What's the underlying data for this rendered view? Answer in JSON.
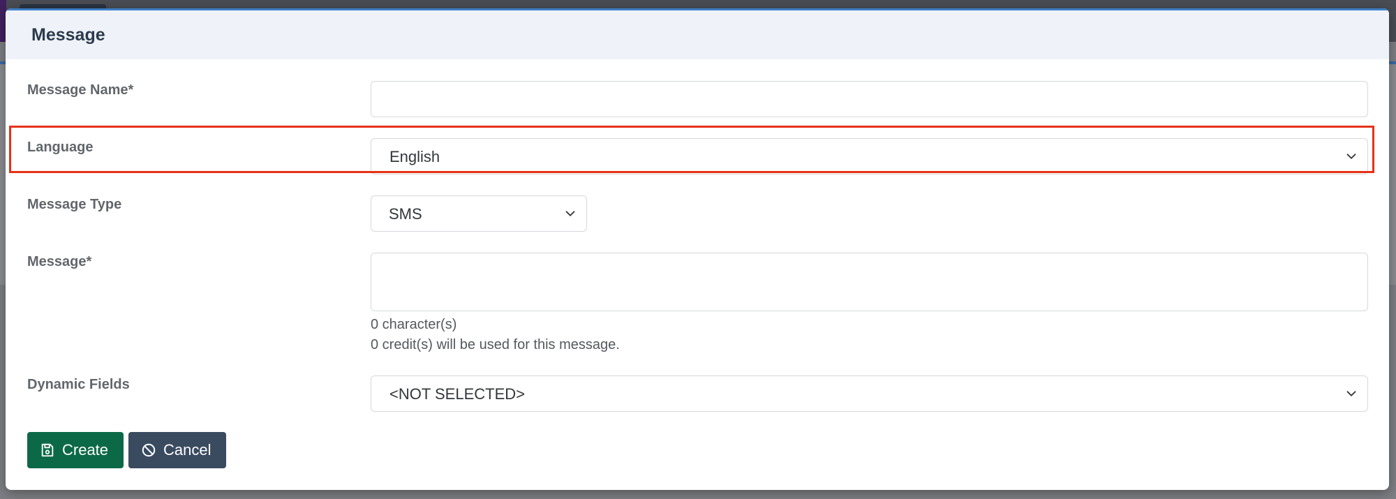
{
  "modal": {
    "title": "Message"
  },
  "form": {
    "message_name": {
      "label": "Message Name*",
      "value": ""
    },
    "language": {
      "label": "Language",
      "selected": "English"
    },
    "message_type": {
      "label": "Message Type",
      "selected": "SMS"
    },
    "message": {
      "label": "Message*",
      "value": ""
    },
    "character_count": "0 character(s)",
    "credit_info": "0 credit(s) will be used for this message.",
    "dynamic_fields": {
      "label": "Dynamic Fields",
      "selected": "<NOT SELECTED>"
    }
  },
  "buttons": {
    "create_label": "Create",
    "cancel_label": "Cancel"
  },
  "icons": {
    "create": "save-icon",
    "cancel": "ban-icon",
    "select": "chevron-down-icon"
  },
  "colors": {
    "create_button": "#0c6947",
    "cancel_button": "#3a4b60",
    "highlight": "#e53217"
  }
}
